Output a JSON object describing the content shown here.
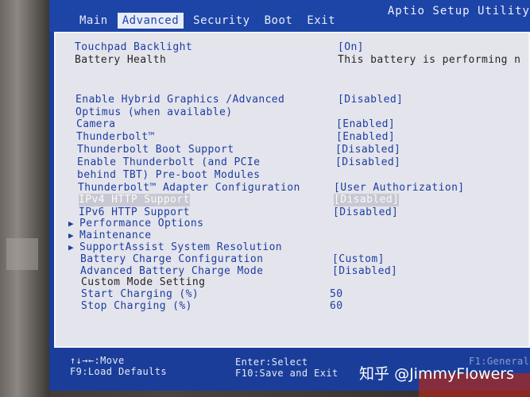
{
  "menu": {
    "tabs": [
      {
        "label": "Main"
      },
      {
        "label": "Advanced"
      },
      {
        "label": "Security"
      },
      {
        "label": "Boot"
      },
      {
        "label": "Exit"
      }
    ],
    "active_tab": "Advanced",
    "brand": "Aptio Setup Utility"
  },
  "settings": [
    {
      "label": "Touchpad Backlight",
      "value": "[On]"
    },
    {
      "label": "Battery Health",
      "value": "This battery is performing n"
    },
    {
      "label": "Enable Hybrid Graphics /Advanced",
      "value": "[Disabled]"
    },
    {
      "label": "Optimus (when available)",
      "value": ""
    },
    {
      "label": "Camera",
      "value": "[Enabled]"
    },
    {
      "label": "Thunderbolt™",
      "value": "[Enabled]"
    },
    {
      "label": "Thunderbolt Boot Support",
      "value": "[Disabled]"
    },
    {
      "label": "Enable Thunderbolt (and PCIe",
      "value": "[Disabled]"
    },
    {
      "label": "behind TBT) Pre-boot Modules",
      "value": ""
    },
    {
      "label": "Thunderbolt™ Adapter Configuration",
      "value": "[User Authorization]"
    },
    {
      "label": "IPv4 HTTP Support",
      "value": "[Disabled]"
    },
    {
      "label": "IPv6 HTTP Support",
      "value": "[Disabled]"
    },
    {
      "label": "Performance Options",
      "value": ""
    },
    {
      "label": "Maintenance",
      "value": ""
    },
    {
      "label": "SupportAssist System Resolution",
      "value": ""
    },
    {
      "label": "Battery Charge Configuration",
      "value": "[Custom]"
    },
    {
      "label": "Advanced Battery Charge Mode",
      "value": "[Disabled]"
    },
    {
      "label": "Custom Mode Setting",
      "value": ""
    },
    {
      "label": "Start Charging (%)",
      "value": "50"
    },
    {
      "label": "Stop Charging (%)",
      "value": "60"
    }
  ],
  "submenu_arrow": "▶",
  "footer": {
    "move": "↑↓→←:Move",
    "load_defaults": "F9:Load Defaults",
    "select": "Enter:Select",
    "save_exit": "F10:Save and Exit",
    "general_help": "F1:General"
  },
  "watermark": "知乎 @JimmyFlowers",
  "colors": {
    "screen_blue": "#1a3d99",
    "panel_gray": "#e4e4ec",
    "text_blue": "#1c3ea0",
    "text_dark": "#262626"
  }
}
